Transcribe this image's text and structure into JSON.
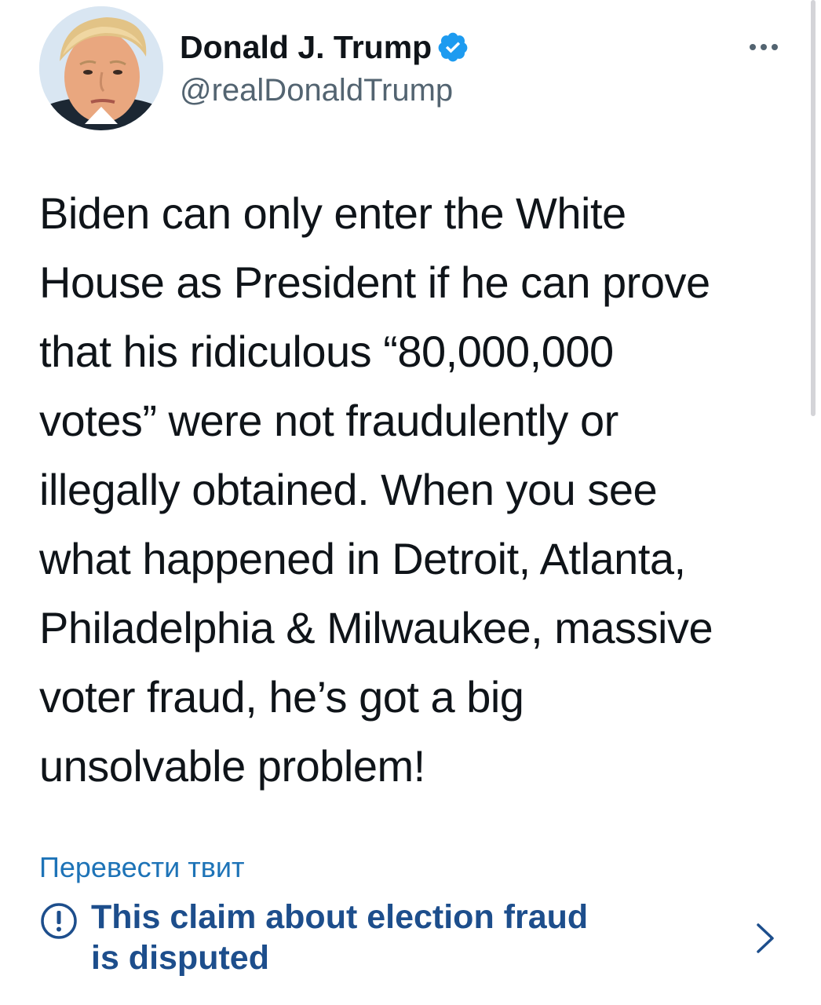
{
  "author": {
    "avatar_icon": "profile-photo",
    "display_name": "Donald J. Trump",
    "handle": "@realDonaldTrump",
    "verified_icon": "verified-badge-icon"
  },
  "menu": {
    "icon": "more-horizontal-icon",
    "glyph": "•••"
  },
  "tweet": {
    "text_lines": [
      "Biden can only enter the White",
      "House as President if he can prove",
      "that his ridiculous “80,000,000",
      "votes” were not fraudulently or",
      "illegally obtained. When you see",
      "what happened in Detroit, Atlanta,",
      "Philadelphia & Milwaukee, massive",
      "voter fraud, he’s got a big",
      "unsolvable problem!"
    ]
  },
  "translate": {
    "label": "Перевести твит"
  },
  "notice": {
    "icon": "exclamation-circle-icon",
    "lines": [
      "This claim about election fraud",
      "is disputed"
    ],
    "chevron_icon": "chevron-right-icon"
  },
  "colors": {
    "text": "#0f1419",
    "secondary": "#536471",
    "link": "#1d73b7",
    "notice": "#1d4e8c",
    "verified": "#1d9bf0"
  }
}
